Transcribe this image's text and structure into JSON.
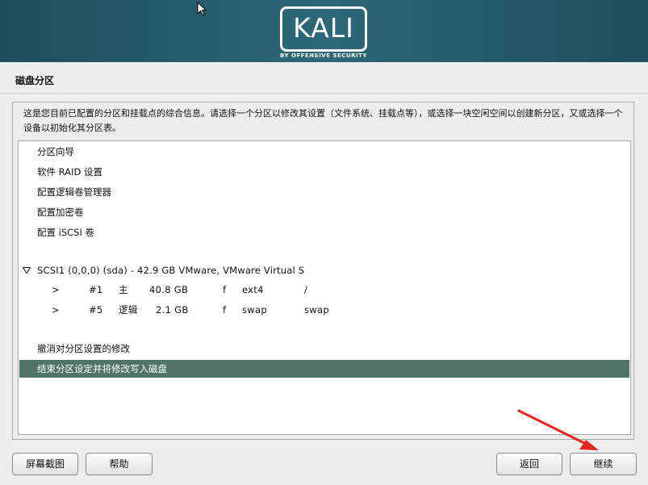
{
  "banner": {
    "logo": "KALI",
    "logo_subtitle": "BY OFFENSIVE SECURITY"
  },
  "page": {
    "title": "磁盘分区",
    "description": "这是您目前已配置的分区和挂载点的综合信息。请选择一个分区以修改其设置（文件系统、挂载点等），或选择一块空闲空间以创建新分区，又或选择一个设备以初始化其分区表。"
  },
  "options": [
    {
      "label": "分区向导"
    },
    {
      "label": "软件 RAID 设置"
    },
    {
      "label": "配置逻辑卷管理器"
    },
    {
      "label": "配置加密卷"
    },
    {
      "label": "配置 iSCSI 卷"
    }
  ],
  "disk": {
    "label": "SCSI1 (0,0,0) (sda) - 42.9 GB VMware, VMware Virtual S",
    "partitions": [
      {
        "arrow": ">",
        "num": "#1",
        "type": "主",
        "size": "40.8 GB",
        "flag": "f",
        "fs": "ext4",
        "mount": "/"
      },
      {
        "arrow": ">",
        "num": "#5",
        "type": "逻辑",
        "size": "2.1 GB",
        "flag": "f",
        "fs": "swap",
        "mount": "swap"
      }
    ]
  },
  "actions": [
    {
      "label": "撤消对分区设置的修改"
    },
    {
      "label": "结束分区设定并将修改写入磁盘",
      "selected": true
    }
  ],
  "buttons": {
    "screenshot": "屏幕截图",
    "help": "帮助",
    "back": "返回",
    "continue": "继续"
  },
  "colors": {
    "banner": "#2c6879",
    "selected_row": "#4f7468",
    "annotation_arrow": "#e8261c"
  }
}
